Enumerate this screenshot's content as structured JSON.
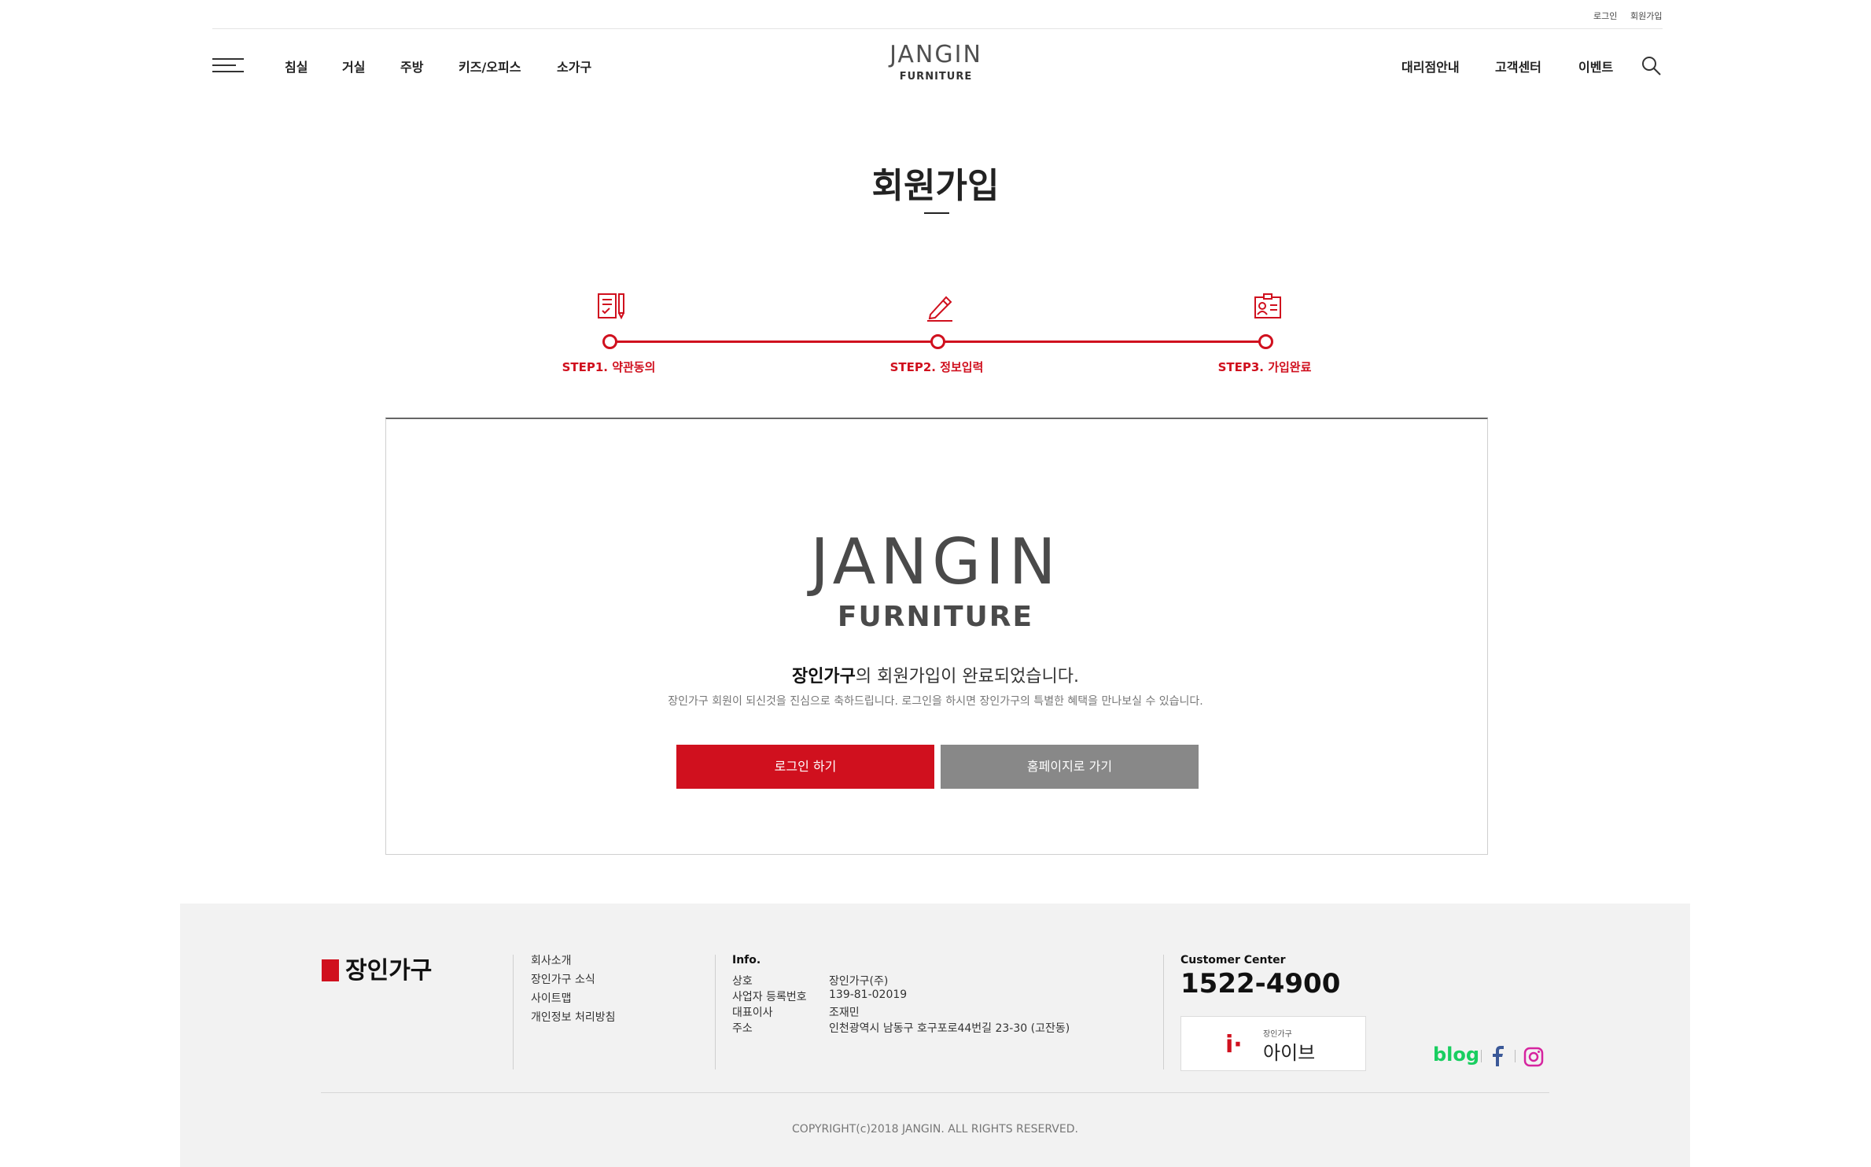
{
  "utility": {
    "login": "로그인",
    "signup": "회원가입"
  },
  "header": {
    "nav_left": [
      "침실",
      "거실",
      "주방",
      "키즈/오피스",
      "소가구"
    ],
    "logo_brand": "JANGIN",
    "logo_sub": "FURNITURE",
    "nav_right": [
      "대리점안내",
      "고객센터",
      "이벤트"
    ],
    "icons": {
      "menu": "hamburger-icon",
      "search": "search-icon"
    }
  },
  "page": {
    "title": "회원가입"
  },
  "steps": [
    {
      "label": "STEP1. 약관동의",
      "icon": "document-check-icon"
    },
    {
      "label": "STEP2. 정보입력",
      "icon": "pencil-icon"
    },
    {
      "label": "STEP3. 가입완료",
      "icon": "id-card-icon"
    }
  ],
  "complete": {
    "logo_brand": "JANGIN",
    "logo_sub": "FURNITURE",
    "message_bold": "장인가구",
    "message_rest": "의 회원가입이 완료되었습니다.",
    "sub_message": "장인가구 회원이 되신것을 진심으로 축하드립니다. 로그인을 하시면 장인가구의 특별한 혜택을 만나보실 수 있습니다.",
    "login_button": "로그인 하기",
    "home_button": "홈페이지로 가기"
  },
  "footer": {
    "logo_text": "장인가구",
    "links": [
      "회사소개",
      "장인가구 소식",
      "사이트맵",
      "개인정보 처리방침"
    ],
    "info_title": "Info.",
    "info": [
      {
        "k": "상호",
        "v": "장인가구(주)"
      },
      {
        "k": "사업자 등록번호",
        "v": "139-81-02019"
      },
      {
        "k": "대표이사",
        "v": "조재민"
      },
      {
        "k": "주소",
        "v": "인천광역시 남동구 호구포로44번길 23-30 (고잔동)"
      }
    ],
    "cc_title": "Customer Center",
    "cc_phone": "1522-4900",
    "ive_small": "장인가구",
    "ive_name": "아이브",
    "blog": "blog",
    "copyright": "COPYRIGHT(c)2018 JANGIN. ALL RIGHTS RESERVED.",
    "colors": {
      "accent": "#d0101e",
      "blog": "#19ce60",
      "facebook": "#3b5998",
      "instagram": "#d6249f"
    }
  }
}
